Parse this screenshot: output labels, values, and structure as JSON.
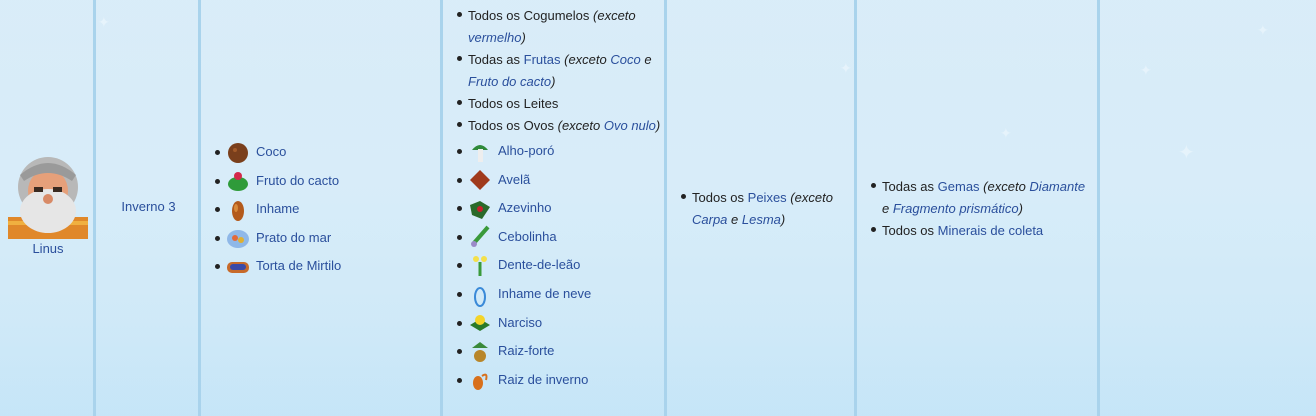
{
  "villager": {
    "name": "Linus"
  },
  "birthday": "Inverno 3",
  "loved": [
    {
      "label": "Coco",
      "icon": "coconut-icon"
    },
    {
      "label": "Fruto do cacto",
      "icon": "cactus-fruit-icon"
    },
    {
      "label": "Inhame",
      "icon": "yam-icon"
    },
    {
      "label": "Prato do mar",
      "icon": "fish-platter-icon"
    },
    {
      "label": "Torta de Mirtilo",
      "icon": "blueberry-tart-icon"
    }
  ],
  "liked_categories": [
    {
      "pre": "Todos os Cogumelos ",
      "tail": "(exceto ",
      "link": "vermelho",
      "close": ")"
    },
    {
      "pre": "Todas as ",
      "link1": "Frutas",
      "tail": " (exceto ",
      "link2": "Coco",
      "mid": " e ",
      "link3": "Fruto do cacto",
      "close": ")"
    },
    {
      "pre": "Todos os Leites"
    },
    {
      "pre": "Todos os Ovos ",
      "tail": "(exceto ",
      "link": "Ovo nulo",
      "close": ")"
    }
  ],
  "liked_items": [
    {
      "label": "Alho-poró",
      "icon": "leek-icon"
    },
    {
      "label": "Avelã",
      "icon": "hazelnut-icon"
    },
    {
      "label": "Azevinho",
      "icon": "holly-icon"
    },
    {
      "label": "Cebolinha",
      "icon": "spring-onion-icon"
    },
    {
      "label": "Dente-de-leão",
      "icon": "dandelion-icon"
    },
    {
      "label": "Inhame de neve",
      "icon": "snow-yam-icon"
    },
    {
      "label": "Narciso",
      "icon": "daffodil-icon"
    },
    {
      "label": "Raiz-forte",
      "icon": "horseradish-icon"
    },
    {
      "label": "Raiz de inverno",
      "icon": "winter-root-icon"
    }
  ],
  "neutral": {
    "pre": "Todos os ",
    "link": "Peixes",
    "tail": " (exceto ",
    "l2": "Carpa",
    "mid": " e ",
    "l3": "Lesma",
    "close": ")"
  },
  "disliked": [
    {
      "pre": "Todas as ",
      "link": "Gemas",
      "tail": " (exceto ",
      "l2": "Diamante",
      "mid": " e ",
      "l3": "Fragmento prismático",
      "close": ")"
    },
    {
      "pre": "Todos os ",
      "link": "Minerais de coleta"
    }
  ]
}
